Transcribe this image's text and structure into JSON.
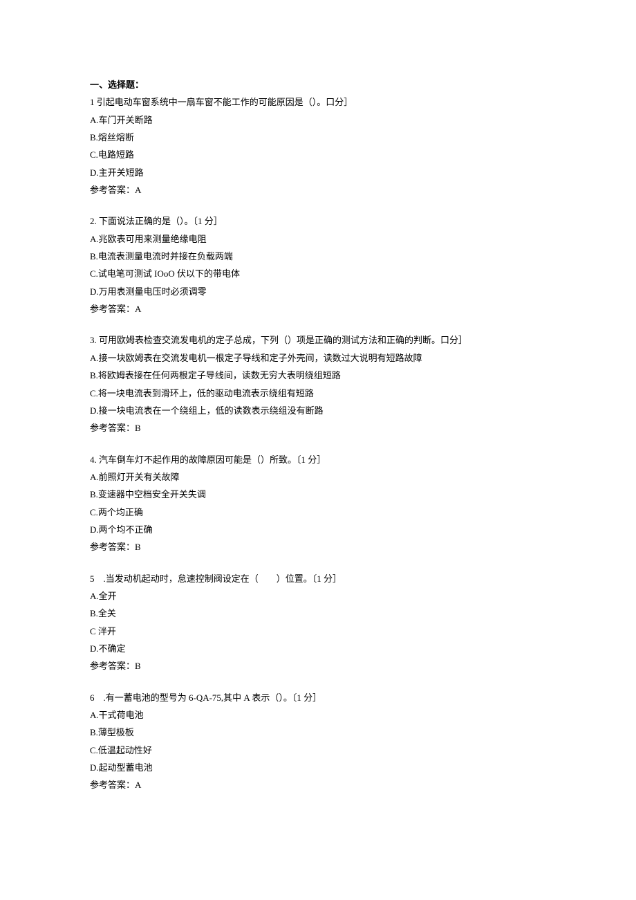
{
  "sectionHeading": "一、选择题：",
  "questions": [
    {
      "stem": "1 引起电动车窗系统中一扇车窗不能工作的可能原因是（）。口分］",
      "options": [
        "A.车门开关断路",
        "B.熔丝熔断",
        "C.电路短路",
        "D.主开关短路"
      ],
      "answer": "参考答案：A"
    },
    {
      "stem": "2. 下面说法正确的是（）。〔1 分］",
      "options": [
        "A.兆欧表可用来测量绝缘电阻",
        "B.电流表测量电流时并接在负载两端",
        "C.试电笔可测试 IOoO 伏以下的带电体",
        "D.万用表测量电压时必须调零"
      ],
      "answer": "参考答案：A"
    },
    {
      "stem": "3. 可用欧姆表检查交流发电机的定子总成，下列（）项是正确的测试方法和正确的判断。口分］",
      "options": [
        "A.接一块欧姆表在交流发电机一根定子导线和定子外壳间，读数过大说明有短路故障",
        "B.将欧姆表接在任何两根定子导线间，读数无穷大表明绕组短路",
        "C.将一块电流表到滑环上，低的驱动电流表示绕组有短路",
        "D.接一块电流表在一个绕组上，低的读数表示绕组没有断路"
      ],
      "answer": "参考答案：B"
    },
    {
      "stem": "4. 汽车倒车灯不起作用的故障原因可能是（）所致。〔1 分］",
      "options": [
        "A.前照灯开关有关故障",
        "B.变速器中空档安全开关失调",
        "C.两个均正确",
        "D.两个均不正确"
      ],
      "answer": "参考答案：B"
    },
    {
      "stem": "5　.当发动机起动时，怠速控制阀设定在（　　）位置。〔1 分］",
      "options": [
        "A.全开",
        "B.全关",
        "C 泮开",
        "D.不确定"
      ],
      "answer": "参考答案：B"
    },
    {
      "stem": "6　.有一蓄电池的型号为 6-QA-75,其中 A 表示（）。〔1 分］",
      "options": [
        "A.干式荷电池",
        "B.薄型极板",
        "C.低温起动性好",
        "D.起动型蓄电池"
      ],
      "answer": "参考答案：A"
    }
  ]
}
